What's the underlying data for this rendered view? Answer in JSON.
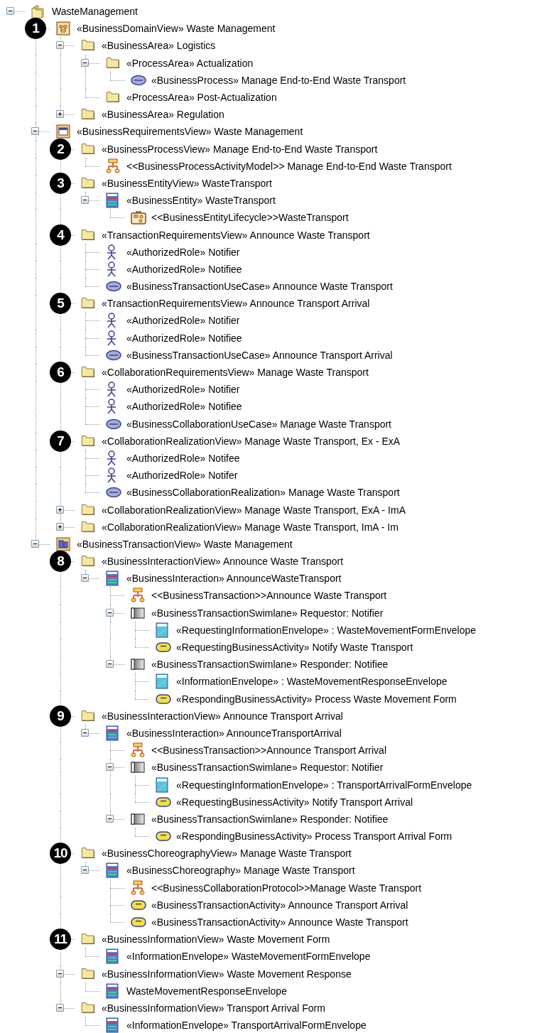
{
  "tree": {
    "label": "WasteManagement",
    "kind": "package",
    "expanded": true,
    "children": [
      {
        "label": "«BusinessDomainView» Waste Management",
        "kind": "domain-view",
        "callout": "1",
        "children": [
          {
            "label": "«BusinessArea» Logistics",
            "kind": "folder",
            "expanded": true,
            "children": [
              {
                "label": "«ProcessArea» Actualization",
                "kind": "folder",
                "expanded": true,
                "children": [
                  {
                    "label": "«BusinessProcess» Manage End-to-End Waste Transport",
                    "kind": "use-case"
                  }
                ]
              },
              {
                "label": "«ProcessArea» Post-Actualization",
                "kind": "folder"
              }
            ]
          },
          {
            "label": "«BusinessArea» Regulation",
            "kind": "folder",
            "expanded": false
          }
        ]
      },
      {
        "label": "«BusinessRequirementsView» Waste Management",
        "kind": "requirements-view",
        "expanded": true,
        "children": [
          {
            "label": "«BusinessProcessView» Manage End-to-End Waste Transport",
            "kind": "folder",
            "callout": "2",
            "children": [
              {
                "label": "<<BusinessProcessActivityModel>> Manage End-to-End Waste Transport",
                "kind": "hierarchy"
              }
            ]
          },
          {
            "label": "«BusinessEntityView» WasteTransport",
            "kind": "folder",
            "callout": "3",
            "children": [
              {
                "label": "«BusinessEntity» WasteTransport",
                "kind": "class",
                "expanded": true,
                "children": [
                  {
                    "label": "<<BusinessEntityLifecycle>>WasteTransport",
                    "kind": "briefcase"
                  }
                ]
              }
            ]
          },
          {
            "label": "«TransactionRequirementsView» Announce Waste Transport",
            "kind": "folder",
            "callout": "4",
            "children": [
              {
                "label": "«AuthorizedRole» Notifier",
                "kind": "actor"
              },
              {
                "label": "«AuthorizedRole» Notifiee",
                "kind": "actor"
              },
              {
                "label": "«BusinessTransactionUseCase» Announce Waste Transport",
                "kind": "use-case"
              }
            ]
          },
          {
            "label": "«TransactionRequirementsView» Announce Transport Arrival",
            "kind": "folder",
            "callout": "5",
            "children": [
              {
                "label": "«AuthorizedRole» Notifier",
                "kind": "actor"
              },
              {
                "label": "«AuthorizedRole» Notifiee",
                "kind": "actor"
              },
              {
                "label": "«BusinessTransactionUseCase» Announce Transport Arrival",
                "kind": "use-case"
              }
            ]
          },
          {
            "label": "«CollaborationRequirementsView» Manage Waste Transport",
            "kind": "folder",
            "callout": "6",
            "children": [
              {
                "label": "«AuthorizedRole» Notifier",
                "kind": "actor"
              },
              {
                "label": "«AuthorizedRole» Notifiee",
                "kind": "actor"
              },
              {
                "label": "«BusinessCollaborationUseCase» Manage Waste Transport",
                "kind": "use-case"
              }
            ]
          },
          {
            "label": "«CollaborationRealizationView» Manage Waste Transport, Ex - ExA",
            "kind": "folder",
            "callout": "7",
            "children": [
              {
                "label": "«AuthorizedRole» Notifee",
                "kind": "actor"
              },
              {
                "label": "«AuthorizedRole» Notifer",
                "kind": "actor"
              },
              {
                "label": "«BusinessCollaborationRealization» Manage Waste Transport",
                "kind": "use-case"
              }
            ]
          },
          {
            "label": "«CollaborationRealizationView» Manage Waste Transport, ExA - ImA",
            "kind": "folder",
            "expanded": false
          },
          {
            "label": "«CollaborationRealizationView» Manage Waste Transport, ImA - Im",
            "kind": "folder",
            "expanded": false
          }
        ]
      },
      {
        "label": "«BusinessTransactionView» Waste Management",
        "kind": "transaction-view",
        "expanded": true,
        "children": [
          {
            "label": "«BusinessInteractionView» Announce Waste Transport",
            "kind": "folder",
            "callout": "8",
            "children": [
              {
                "label": "«BusinessInteraction» AnnounceWasteTransport",
                "kind": "class",
                "expanded": true,
                "children": [
                  {
                    "label": "<<BusinessTransaction>>Announce Waste Transport",
                    "kind": "hierarchy"
                  },
                  {
                    "label": "«BusinessTransactionSwimlane» Requestor: Notifier",
                    "kind": "swimlane",
                    "expanded": true,
                    "children": [
                      {
                        "label": "«RequestingInformationEnvelope» : WasteMovementFormEnvelope",
                        "kind": "document"
                      },
                      {
                        "label": "«RequestingBusinessActivity» Notify Waste Transport",
                        "kind": "activity"
                      }
                    ]
                  },
                  {
                    "label": "«BusinessTransactionSwimlane» Responder: Notifiee",
                    "kind": "swimlane",
                    "expanded": true,
                    "children": [
                      {
                        "label": "«InformationEnvelope» : WasteMovementResponseEnvelope",
                        "kind": "document"
                      },
                      {
                        "label": "«RespondingBusinessActivity» Process Waste Movement Form",
                        "kind": "activity"
                      }
                    ]
                  }
                ]
              }
            ]
          },
          {
            "label": "«BusinessInteractionView» Announce Transport Arrival",
            "kind": "folder",
            "callout": "9",
            "children": [
              {
                "label": "«BusinessInteraction» AnnounceTransportArrival",
                "kind": "class",
                "expanded": true,
                "children": [
                  {
                    "label": "<<BusinessTransaction>>Announce Transport Arrival",
                    "kind": "hierarchy"
                  },
                  {
                    "label": "«BusinessTransactionSwimlane» Requestor: Notifier",
                    "kind": "swimlane",
                    "expanded": true,
                    "children": [
                      {
                        "label": "«RequestingInformationEnvelope» : TransportArrivalFormEnvelope",
                        "kind": "document"
                      },
                      {
                        "label": "«RequestingBusinessActivity» Notify Transport Arrival",
                        "kind": "activity"
                      }
                    ]
                  },
                  {
                    "label": "«BusinessTransactionSwimlane» Responder: Notifiee",
                    "kind": "swimlane",
                    "expanded": true,
                    "children": [
                      {
                        "label": "«RespondingBusinessActivity» Process Transport Arrival Form",
                        "kind": "activity"
                      }
                    ]
                  }
                ]
              }
            ]
          },
          {
            "label": "«BusinessChoreographyView» Manage Waste Transport",
            "kind": "folder",
            "callout": "10",
            "children": [
              {
                "label": "«BusinessChoreography» Manage Waste Transport",
                "kind": "class",
                "expanded": true,
                "children": [
                  {
                    "label": "<<BusinessCollaborationProtocol>>Manage Waste Transport",
                    "kind": "hierarchy"
                  },
                  {
                    "label": "«BusinessTransactionActivity» Announce Transport Arrival",
                    "kind": "activity"
                  },
                  {
                    "label": "«BusinessTransactionActivity» Announce Waste Transport",
                    "kind": "activity"
                  }
                ]
              }
            ]
          },
          {
            "label": "«BusinessInformationView» Waste Movement Form",
            "kind": "folder",
            "callout": "11",
            "children": [
              {
                "label": "«InformationEnvelope» WasteMovementFormEnvelope",
                "kind": "class"
              }
            ]
          },
          {
            "label": "«BusinessInformationView» Waste Movement Response",
            "kind": "folder",
            "expanded": true,
            "children": [
              {
                "label": "WasteMovementResponseEnvelope",
                "kind": "class"
              }
            ]
          },
          {
            "label": "«BusinessInformationView» Transport Arrival Form",
            "kind": "folder",
            "expanded": true,
            "children": [
              {
                "label": "«InformationEnvelope» TransportArrivalFormEnvelope",
                "kind": "class"
              }
            ]
          }
        ]
      }
    ]
  }
}
